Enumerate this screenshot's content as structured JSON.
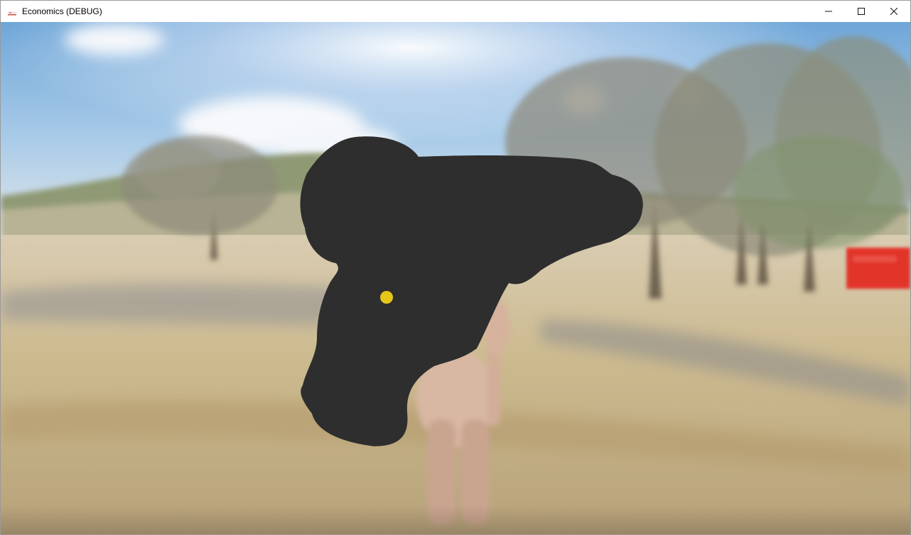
{
  "window": {
    "title": "Economics (DEBUG)",
    "app_icon": "unity-icon",
    "controls": {
      "minimize": "minimize-icon",
      "maximize": "maximize-icon",
      "close": "close-icon"
    }
  },
  "scene": {
    "sky_color": "#8fbfe6",
    "ground_color": "#c9b98f",
    "blob_color": "#2e2e2e",
    "marker_color": "#e6c619",
    "red_sign_color": "#e0322a"
  },
  "status_bar": {
    "text": ""
  }
}
